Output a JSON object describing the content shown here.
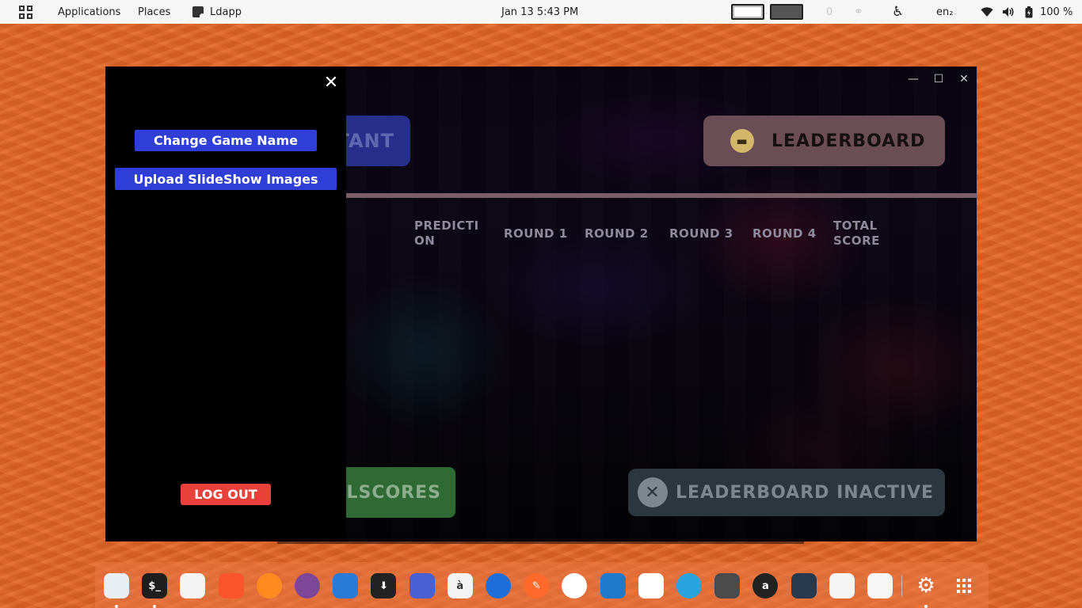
{
  "topbar": {
    "applications": "Applications",
    "places": "Places",
    "active_app": "Ldapp",
    "clock": "Jan 13  5:43 PM",
    "indicator_zero": "0",
    "keyboard_layout": "en₂",
    "battery": "100 %"
  },
  "window": {
    "controls": {
      "minimize": "—",
      "maximize": "☐",
      "close": "✕"
    }
  },
  "app": {
    "contestant_button_visible": "TANT",
    "leaderboard_button": "LEADERBOARD",
    "columns": [
      "PREDICTI ON",
      "ROUND 1",
      "ROUND 2",
      "ROUND 3",
      "ROUND 4",
      "TOTAL SCORE"
    ],
    "scores_button_visible": "LSCORES",
    "leaderboard_status": "LEADERBOARD INACTIVE"
  },
  "drawer": {
    "close": "✕",
    "change_game_name": "Change Game Name",
    "upload_slideshow": "Upload SlideShow Images",
    "logout": "LOG OUT"
  },
  "dock": {
    "items": [
      {
        "name": "files",
        "glyph": "",
        "color": "#e9eef5"
      },
      {
        "name": "terminal",
        "glyph": "$_",
        "color": "#1e1e1e"
      },
      {
        "name": "text-editor",
        "glyph": "",
        "color": "#f4f4f4"
      },
      {
        "name": "brave",
        "glyph": "",
        "color": "#fb542b"
      },
      {
        "name": "firefox",
        "glyph": "",
        "color": "#ff8a1f"
      },
      {
        "name": "tor-browser",
        "glyph": "",
        "color": "#7d4698"
      },
      {
        "name": "birdie",
        "glyph": "",
        "color": "#2a7bd8"
      },
      {
        "name": "downloader",
        "glyph": "⬇",
        "color": "#222222"
      },
      {
        "name": "screen-recorder",
        "glyph": "",
        "color": "#4a5fd1"
      },
      {
        "name": "font-viewer",
        "glyph": "à",
        "color": "#f3f3f3"
      },
      {
        "name": "browser",
        "glyph": "",
        "color": "#1e6fd9"
      },
      {
        "name": "pencil-app",
        "glyph": "✎",
        "color": "#ff6a2b"
      },
      {
        "name": "appimage",
        "glyph": "",
        "color": "#ffffff"
      },
      {
        "name": "vscode",
        "glyph": "",
        "color": "#1f7acc"
      },
      {
        "name": "slack",
        "glyph": "",
        "color": "#ffffff"
      },
      {
        "name": "telegram",
        "glyph": "",
        "color": "#2aa3e0"
      },
      {
        "name": "calculator",
        "glyph": "",
        "color": "#4b4b4b"
      },
      {
        "name": "amazon",
        "glyph": "a",
        "color": "#222222"
      },
      {
        "name": "system-monitor",
        "glyph": "",
        "color": "#26394d"
      },
      {
        "name": "image-viewer",
        "glyph": "",
        "color": "#f5f5f5"
      },
      {
        "name": "app-center",
        "glyph": "",
        "color": "#f6f6f6"
      },
      {
        "name": "settings",
        "glyph": "⚙",
        "color": "transparent"
      },
      {
        "name": "app-grid",
        "glyph": "",
        "color": "transparent"
      }
    ]
  }
}
